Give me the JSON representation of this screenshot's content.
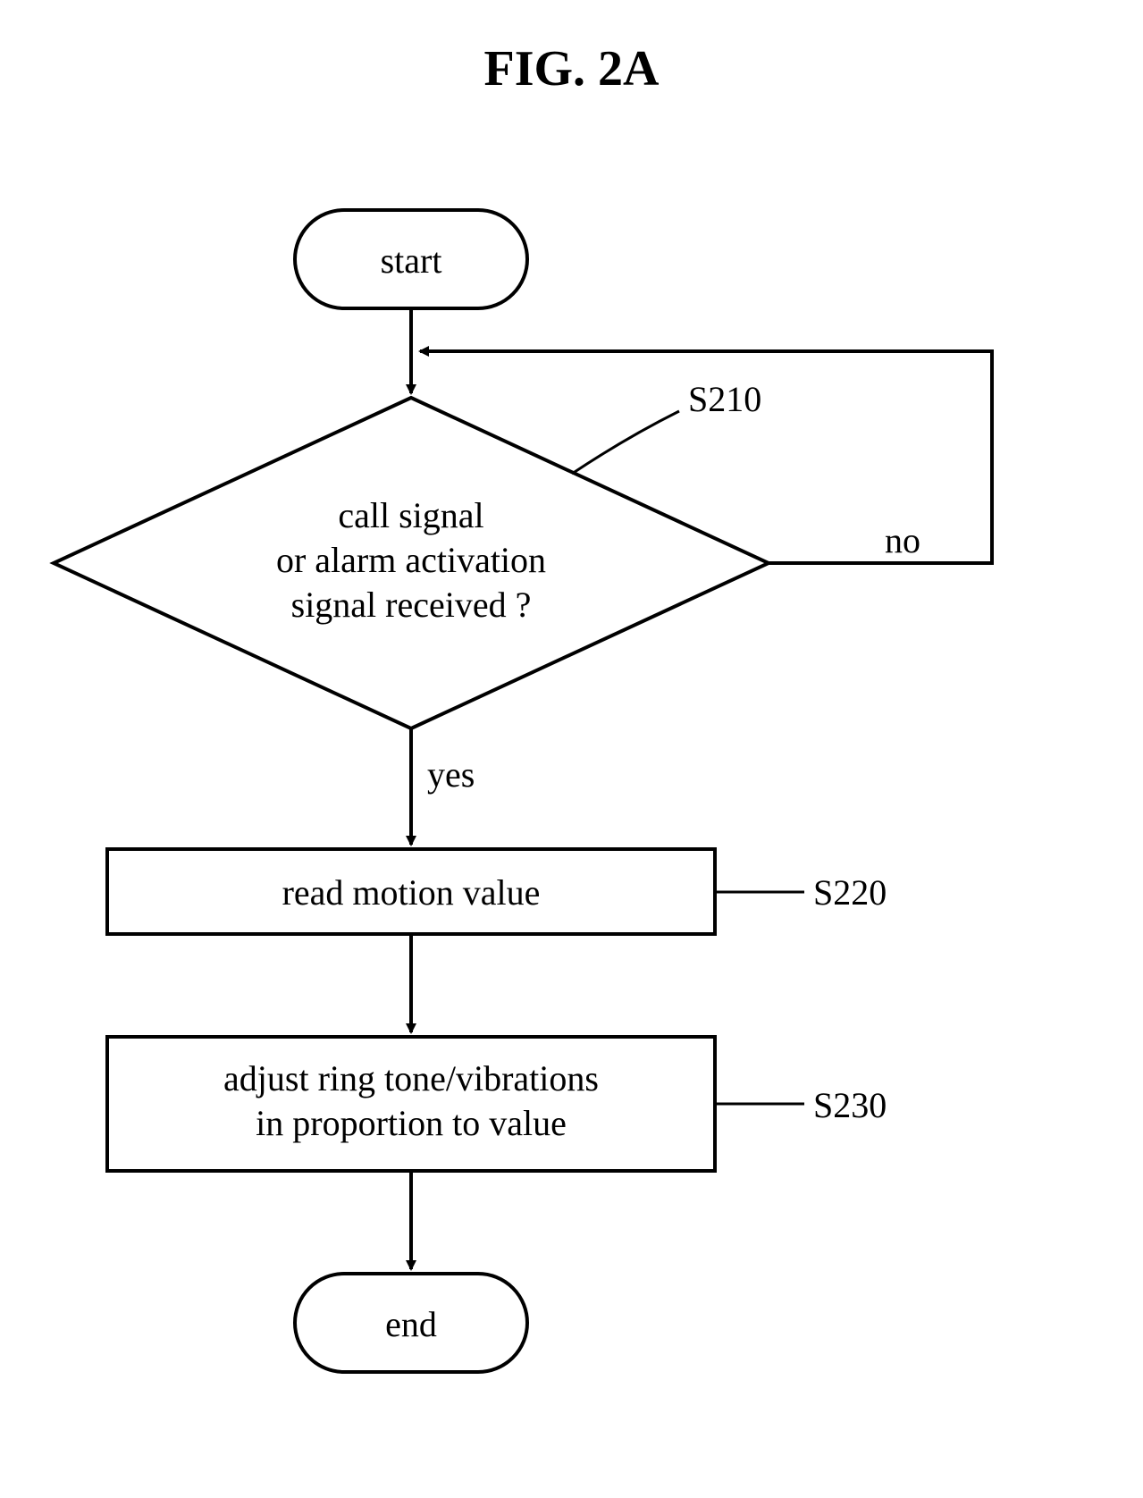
{
  "figure": {
    "title": "FIG. 2A",
    "nodes": {
      "start": "start",
      "decision_line1": "call signal",
      "decision_line2": "or alarm activation",
      "decision_line3": "signal received ?",
      "process1": "read motion value",
      "process2_line1": "adjust ring tone/vibrations",
      "process2_line2": "in proportion to value",
      "end": "end"
    },
    "edges": {
      "yes": "yes",
      "no": "no"
    },
    "refs": {
      "s210": "S210",
      "s220": "S220",
      "s230": "S230"
    }
  }
}
